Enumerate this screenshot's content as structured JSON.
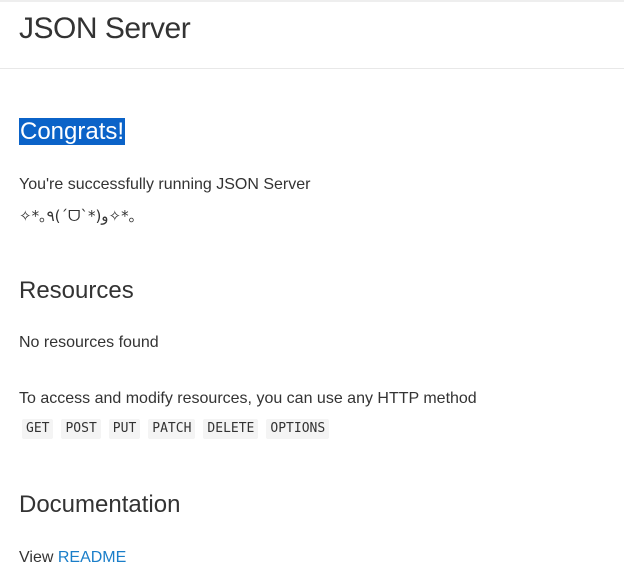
{
  "header": {
    "title": "JSON Server"
  },
  "intro": {
    "heading": "Congrats!",
    "text": "You're successfully running JSON Server",
    "kaomoji": "✧*｡٩(ˊᗜˋ*)و✧*｡"
  },
  "resources": {
    "heading": "Resources",
    "empty_text": "No resources found",
    "access_text": "To access and modify resources, you can use any HTTP method",
    "methods": [
      "GET",
      "POST",
      "PUT",
      "PATCH",
      "DELETE",
      "OPTIONS"
    ]
  },
  "documentation": {
    "heading": "Documentation",
    "view_text": "View",
    "readme_link": "README"
  },
  "colors": {
    "selection_highlight": "#0b63c8",
    "link": "#1a7ec9"
  }
}
